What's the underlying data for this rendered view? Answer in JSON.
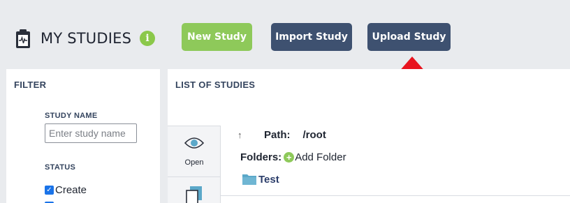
{
  "header": {
    "title": "MY STUDIES",
    "info_icon": "i",
    "buttons": {
      "new_study": "New Study",
      "import_study": "Import Study",
      "upload_study": "Upload Study"
    }
  },
  "filter": {
    "title": "FILTER",
    "study_name_label": "STUDY NAME",
    "study_name_placeholder": "Enter study name",
    "status_label": "STATUS",
    "statuses": [
      {
        "label": "Create",
        "checked": true
      }
    ]
  },
  "list": {
    "title": "LIST OF STUDIES",
    "tools": {
      "open_label": "Open"
    },
    "path_label": "Path:",
    "path_value": "/root",
    "folders_label": "Folders:",
    "add_folder_label": "Add Folder",
    "folders": [
      "Test"
    ]
  },
  "colors": {
    "new_button": "#8ec95a",
    "dark_button": "#3e5170",
    "arrow": "#e8141f",
    "info": "#8bc84a"
  },
  "icons": [
    "clipboard-icon",
    "info-icon",
    "eye-icon",
    "copy-icon",
    "up-arrow-icon",
    "add-icon",
    "folder-icon",
    "red-arrow-pointer"
  ]
}
